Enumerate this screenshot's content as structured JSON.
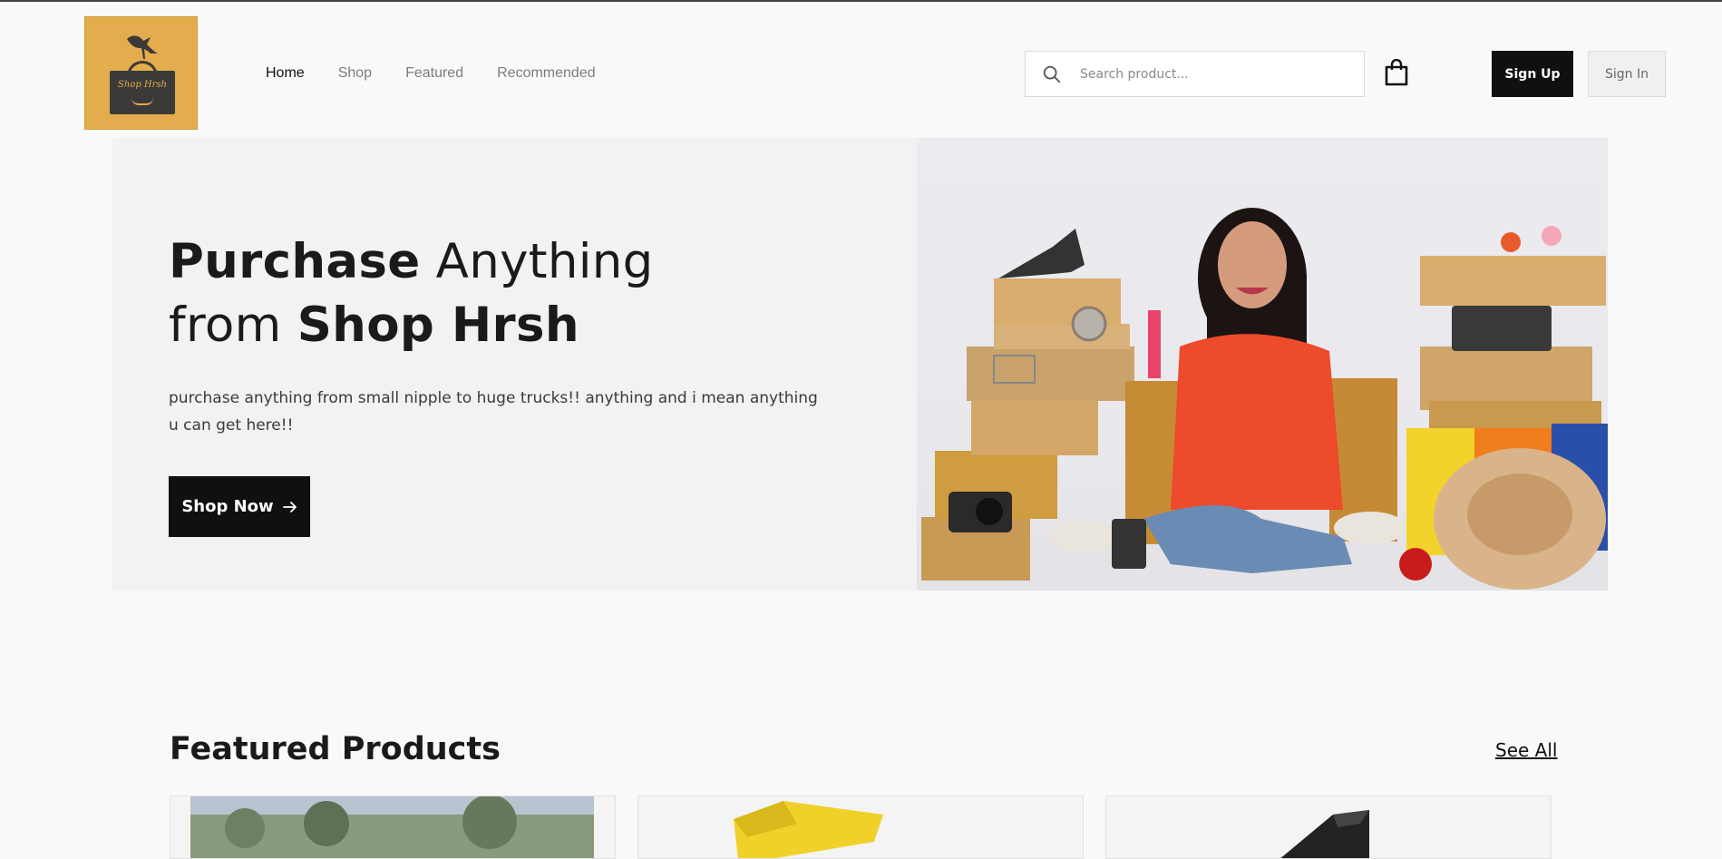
{
  "brand": {
    "logo_text": "Shop Hrsh",
    "logo_bg": "#e3ac4d",
    "icon": "shopping-bag-logo"
  },
  "nav": {
    "items": [
      {
        "label": "Home",
        "active": true
      },
      {
        "label": "Shop",
        "active": false
      },
      {
        "label": "Featured",
        "active": false
      },
      {
        "label": "Recommended",
        "active": false
      }
    ]
  },
  "search": {
    "placeholder": "Search product...",
    "value": "",
    "icon": "search-icon"
  },
  "cart": {
    "icon": "shopping-bag-icon"
  },
  "auth": {
    "signup_label": "Sign Up",
    "signin_label": "Sign In"
  },
  "hero": {
    "title_bold_1": "Purchase",
    "title_light_1": " Anything",
    "title_light_2": "from ",
    "title_bold_2": "Shop Hrsh",
    "description": "purchase anything from small nipple to huge trucks!! anything and i mean anything u can get here!!",
    "cta_label": "Shop Now",
    "cta_icon": "arrow-right-icon"
  },
  "featured": {
    "title": "Featured Products",
    "see_all_label": "See All"
  },
  "colors": {
    "background": "#f9f9f9",
    "primary_button": "#101010",
    "hero_bg": "#f2f2f2",
    "accent": "#e3ac4d"
  }
}
